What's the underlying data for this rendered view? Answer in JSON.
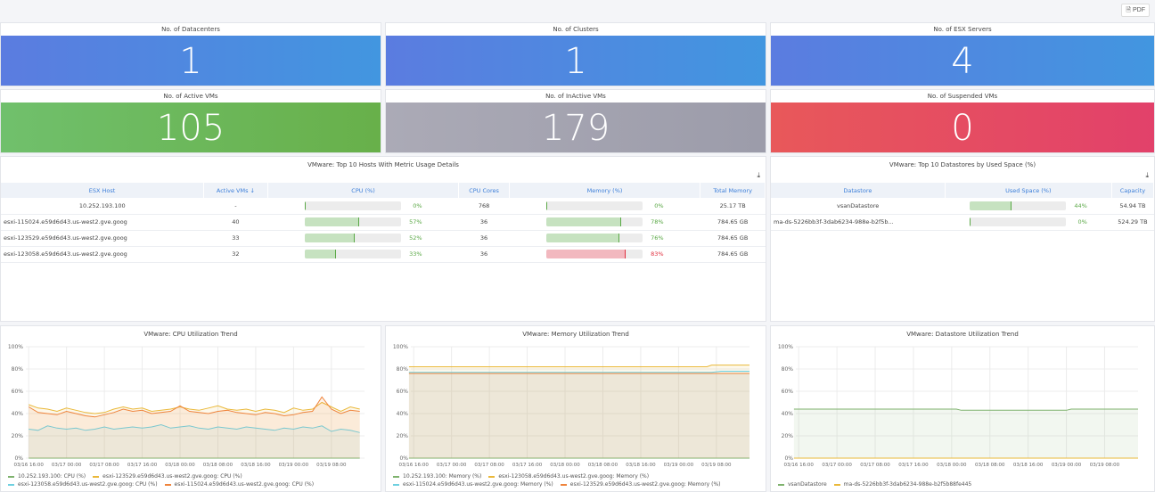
{
  "toolbar": {
    "pdf_label": "PDF"
  },
  "stats": [
    {
      "title": "No. of Datacenters",
      "value": "1",
      "color": "#4f8ae0"
    },
    {
      "title": "No. of Clusters",
      "value": "1",
      "color": "#4f8ae0"
    },
    {
      "title": "No. of ESX Servers",
      "value": "4",
      "color": "#4f8ae0"
    },
    {
      "title": "No. of Active VMs",
      "value": "105",
      "color": "#6cb85a"
    },
    {
      "title": "No. of InActive VMs",
      "value": "179",
      "color": "#a4a4b0"
    },
    {
      "title": "No. of Suspended VMs",
      "value": "0",
      "color": "#e44c63"
    }
  ],
  "hosts_table": {
    "title": "VMware: Top 10 Hosts With Metric Usage Details",
    "columns": [
      "ESX Host",
      "Active VMs ↓",
      "CPU (%)",
      "CPU Cores",
      "Memory (%)",
      "Total Memory"
    ],
    "rows": [
      {
        "host": "10.252.193.100",
        "active_vms": "-",
        "cpu": 0,
        "cpu_label": "0%",
        "cores": "768",
        "mem": 0,
        "mem_label": "0%",
        "total": "25.17 TB"
      },
      {
        "host": "esxi-115024.e59d6d43.us-west2.gve.goog",
        "active_vms": "40",
        "cpu": 57,
        "cpu_label": "57%",
        "cores": "36",
        "mem": 78,
        "mem_label": "78%",
        "total": "784.65 GB"
      },
      {
        "host": "esxi-123529.e59d6d43.us-west2.gve.goog",
        "active_vms": "33",
        "cpu": 52,
        "cpu_label": "52%",
        "cores": "36",
        "mem": 76,
        "mem_label": "76%",
        "total": "784.65 GB"
      },
      {
        "host": "esxi-123058.e59d6d43.us-west2.gve.goog",
        "active_vms": "32",
        "cpu": 33,
        "cpu_label": "33%",
        "cores": "36",
        "mem": 83,
        "mem_label": "83%",
        "total": "784.65 GB"
      }
    ]
  },
  "ds_table": {
    "title": "VMware: Top 10 Datastores by Used Space (%)",
    "columns": [
      "Datastore",
      "Used Space (%)",
      "Capacity"
    ],
    "rows": [
      {
        "name": "vsanDatastore",
        "used": 44,
        "used_label": "44%",
        "capacity": "54.94 TB"
      },
      {
        "name": "ma-ds-5226bb3f-3dab6234-988e-b2f5b...",
        "used": 0,
        "used_label": "0%",
        "capacity": "524.29 TB"
      }
    ]
  },
  "chart_data": [
    {
      "type": "line",
      "title": "VMware: CPU Utilization Trend",
      "ylim": [
        0,
        100
      ],
      "yticks": [
        "0%",
        "20%",
        "40%",
        "60%",
        "80%",
        "100%"
      ],
      "xticks": [
        "03/16 16:00",
        "03/17 00:00",
        "03/17 08:00",
        "03/17 16:00",
        "03/18 00:00",
        "03/18 08:00",
        "03/18 16:00",
        "03/19 00:00",
        "03/19 08:00"
      ],
      "grid": true,
      "legend": "bottom",
      "x": [
        "03/16 16:00",
        "03/16 18:00",
        "03/16 20:00",
        "03/16 22:00",
        "03/17 00:00",
        "03/17 02:00",
        "03/17 04:00",
        "03/17 06:00",
        "03/17 08:00",
        "03/17 10:00",
        "03/17 12:00",
        "03/17 14:00",
        "03/17 16:00",
        "03/17 18:00",
        "03/17 20:00",
        "03/17 22:00",
        "03/18 00:00",
        "03/18 02:00",
        "03/18 04:00",
        "03/18 06:00",
        "03/18 08:00",
        "03/18 10:00",
        "03/18 12:00",
        "03/18 14:00",
        "03/18 16:00",
        "03/18 18:00",
        "03/18 20:00",
        "03/18 22:00",
        "03/19 00:00",
        "03/19 02:00",
        "03/19 04:00",
        "03/19 06:00",
        "03/19 08:00",
        "03/19 10:00",
        "03/19 12:00",
        "03/19 14:00"
      ],
      "series": [
        {
          "name": "10.252.193.100: CPU (%)",
          "color": "#7eb26d",
          "values": [
            0,
            0,
            0,
            0,
            0,
            0,
            0,
            0,
            0,
            0,
            0,
            0,
            0,
            0,
            0,
            0,
            0,
            0,
            0,
            0,
            0,
            0,
            0,
            0,
            0,
            0,
            0,
            0,
            0,
            0,
            0,
            0,
            0,
            0,
            0,
            0
          ]
        },
        {
          "name": "esxi-123529.e59d6d43.us-west2.gve.goog: CPU (%)",
          "color": "#eab839",
          "values": [
            48,
            45,
            44,
            42,
            45,
            43,
            41,
            40,
            41,
            44,
            46,
            44,
            45,
            42,
            43,
            44,
            46,
            44,
            43,
            45,
            47,
            44,
            43,
            44,
            42,
            44,
            43,
            41,
            45,
            43,
            44,
            50,
            46,
            42,
            46,
            44
          ]
        },
        {
          "name": "esxi-123058.e59d6d43.us-west2.gve.goog: CPU (%)",
          "color": "#6ed0e0",
          "values": [
            26,
            25,
            29,
            27,
            26,
            27,
            25,
            26,
            28,
            26,
            27,
            28,
            27,
            28,
            30,
            27,
            28,
            29,
            27,
            26,
            28,
            27,
            26,
            28,
            27,
            26,
            25,
            27,
            26,
            28,
            27,
            29,
            24,
            26,
            25,
            23
          ]
        },
        {
          "name": "esxi-115024.e59d6d43.us-west2.gve.goog: CPU (%)",
          "color": "#ef843c",
          "values": [
            46,
            41,
            40,
            39,
            42,
            40,
            38,
            37,
            39,
            41,
            44,
            42,
            43,
            40,
            41,
            42,
            47,
            42,
            41,
            40,
            42,
            43,
            41,
            40,
            39,
            41,
            40,
            38,
            39,
            41,
            42,
            55,
            44,
            40,
            43,
            42
          ]
        }
      ]
    },
    {
      "type": "line",
      "title": "VMware: Memory Utilization Trend",
      "ylim": [
        0,
        100
      ],
      "yticks": [
        "0%",
        "20%",
        "40%",
        "60%",
        "80%",
        "100%"
      ],
      "xticks": [
        "03/16 16:00",
        "03/17 00:00",
        "03/17 08:00",
        "03/17 16:00",
        "03/18 00:00",
        "03/18 08:00",
        "03/18 16:00",
        "03/19 00:00",
        "03/19 08:00"
      ],
      "grid": true,
      "legend": "bottom",
      "x": [
        "03/16 15:00",
        "03/19 06:00",
        "03/19 07:00",
        "03/19 09:00",
        "03/19 15:00"
      ],
      "series": [
        {
          "name": "10.252.193.100: Memory (%)",
          "color": "#7eb26d",
          "values": [
            0,
            0,
            0,
            0,
            0
          ]
        },
        {
          "name": "esxi-123058.e59d6d43.us-west2.gve.goog: Memory (%)",
          "color": "#eab839",
          "values": [
            82,
            82,
            83.5,
            83.5,
            83.5
          ]
        },
        {
          "name": "esxi-115024.e59d6d43.us-west2.gve.goog: Memory (%)",
          "color": "#6ed0e0",
          "values": [
            77,
            77,
            77,
            78,
            78
          ]
        },
        {
          "name": "esxi-123529.e59d6d43.us-west2.gve.goog: Memory (%)",
          "color": "#ef843c",
          "values": [
            76,
            76,
            76,
            76,
            76
          ]
        }
      ]
    },
    {
      "type": "line",
      "title": "VMware: Datastore Utilization Trend",
      "ylim": [
        0,
        100
      ],
      "yticks": [
        "0%",
        "20%",
        "40%",
        "60%",
        "80%",
        "100%"
      ],
      "xticks": [
        "03/16 16:00",
        "03/17 00:00",
        "03/17 08:00",
        "03/17 16:00",
        "03/18 00:00",
        "03/18 08:00",
        "03/18 16:00",
        "03/19 00:00",
        "03/19 08:00"
      ],
      "grid": true,
      "legend": "bottom",
      "x": [
        "03/16 15:00",
        "03/18 01:00",
        "03/18 02:00",
        "03/19 00:00",
        "03/19 01:00",
        "03/19 15:00"
      ],
      "series": [
        {
          "name": "vsanDatastore",
          "color": "#7eb26d",
          "values": [
            44,
            44,
            43,
            43,
            44,
            44
          ]
        },
        {
          "name": "ma-ds-5226bb3f-3dab6234-988e-b2f5b88fe445",
          "color": "#eab839",
          "values": [
            0,
            0,
            0,
            0,
            0,
            0
          ]
        }
      ]
    }
  ]
}
